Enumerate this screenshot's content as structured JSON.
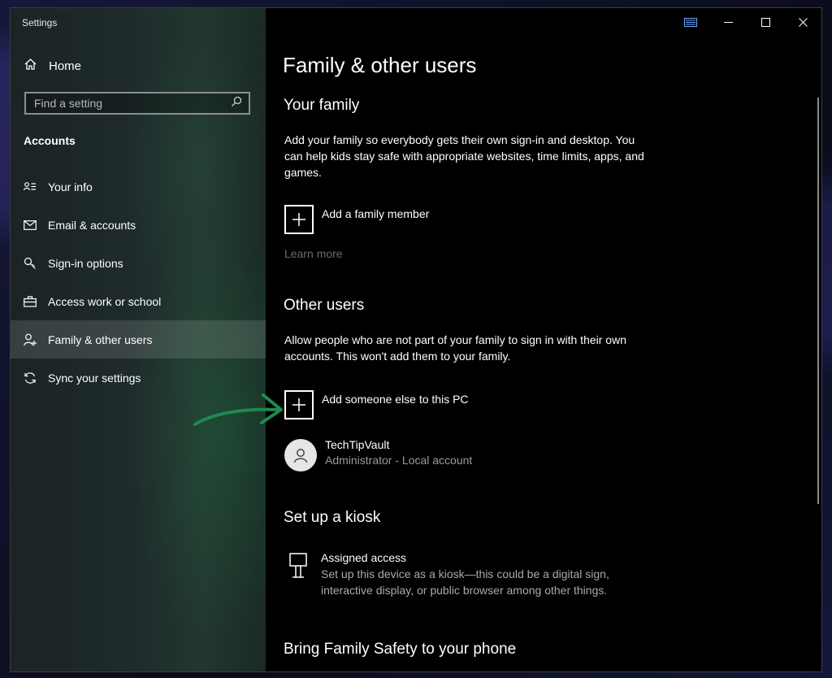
{
  "window": {
    "title": "Settings"
  },
  "sidebar": {
    "home_label": "Home",
    "search_placeholder": "Find a setting",
    "section_header": "Accounts",
    "items": [
      {
        "label": "Your info",
        "icon": "person-card-icon",
        "active": false
      },
      {
        "label": "Email & accounts",
        "icon": "mail-icon",
        "active": false
      },
      {
        "label": "Sign-in options",
        "icon": "key-icon",
        "active": false
      },
      {
        "label": "Access work or school",
        "icon": "briefcase-icon",
        "active": false
      },
      {
        "label": "Family & other users",
        "icon": "person-add-icon",
        "active": true
      },
      {
        "label": "Sync your settings",
        "icon": "sync-icon",
        "active": false
      }
    ]
  },
  "main": {
    "page_title": "Family & other users",
    "your_family": {
      "heading": "Your family",
      "description": "Add your family so everybody gets their own sign-in and desktop. You can help kids stay safe with appropriate websites, time limits, apps, and games.",
      "add_label": "Add a family member",
      "learn_more": "Learn more"
    },
    "other_users": {
      "heading": "Other users",
      "description": "Allow people who are not part of your family to sign in with their own accounts. This won't add them to your family.",
      "add_label": "Add someone else to this PC",
      "user": {
        "name": "TechTipVault",
        "role": "Administrator - Local account"
      }
    },
    "kiosk": {
      "heading": "Set up a kiosk",
      "item_title": "Assigned access",
      "item_description": "Set up this device as a kiosk—this could be a digital sign, interactive display, or public browser among other things."
    },
    "family_safety": {
      "heading": "Bring Family Safety to your phone"
    }
  },
  "colors": {
    "annotation_arrow": "#1e8a4f",
    "active_nav": "#3a4244",
    "muted_text": "#6b6b6b"
  }
}
